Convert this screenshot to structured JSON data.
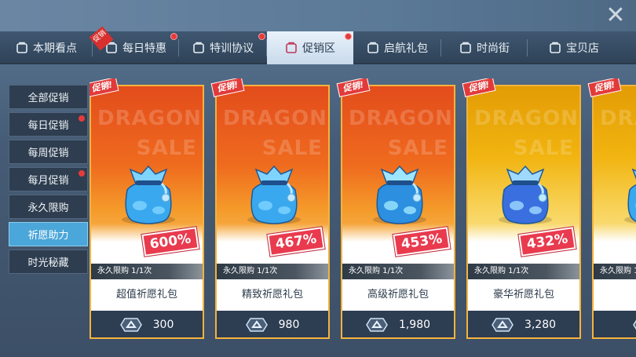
{
  "tabs": [
    {
      "label": "本期看点",
      "icon": "lock-bag-icon",
      "has_dot": false,
      "has_promo_tag": false,
      "active": false
    },
    {
      "label": "每日特惠",
      "icon": "flower-icon",
      "has_dot": true,
      "has_promo_tag": true,
      "active": false
    },
    {
      "label": "特训协议",
      "icon": "wings-icon",
      "has_dot": true,
      "has_promo_tag": false,
      "active": false
    },
    {
      "label": "促销区",
      "icon": "discount-icon",
      "has_dot": true,
      "has_promo_tag": false,
      "active": true
    },
    {
      "label": "启航礼包",
      "icon": "gift-icon",
      "has_dot": false,
      "has_promo_tag": false,
      "active": false
    },
    {
      "label": "时尚街",
      "icon": "hanger-icon",
      "has_dot": false,
      "has_promo_tag": false,
      "active": false
    },
    {
      "label": "宝贝店",
      "icon": "shop-icon",
      "has_dot": false,
      "has_promo_tag": false,
      "active": false
    }
  ],
  "promo_tag_text": "促销",
  "sidebar": [
    {
      "label": "全部促销",
      "active": false,
      "has_dot": false
    },
    {
      "label": "每日促销",
      "active": false,
      "has_dot": true
    },
    {
      "label": "每周促销",
      "active": false,
      "has_dot": false
    },
    {
      "label": "每月促销",
      "active": false,
      "has_dot": true
    },
    {
      "label": "永久限购",
      "active": false,
      "has_dot": false
    },
    {
      "label": "祈愿助力",
      "active": true,
      "has_dot": false
    },
    {
      "label": "时光秘藏",
      "active": false,
      "has_dot": false
    }
  ],
  "corner_tag": "促销!",
  "watermark": {
    "line1": "DRAGON",
    "line2": "SALE"
  },
  "cards": [
    {
      "percent": "600%",
      "limit": "永久限购 1/1次",
      "name": "超值祈愿礼包",
      "price": "300",
      "theme": "orange"
    },
    {
      "percent": "467%",
      "limit": "永久限购 1/1次",
      "name": "精致祈愿礼包",
      "price": "980",
      "theme": "orange"
    },
    {
      "percent": "453%",
      "limit": "永久限购 1/1次",
      "name": "高级祈愿礼包",
      "price": "1,980",
      "theme": "orange"
    },
    {
      "percent": "432%",
      "limit": "永久限购 1/1次",
      "name": "豪华祈愿礼包",
      "price": "3,280",
      "theme": "gold"
    },
    {
      "percent": "",
      "limit": "永久限购 1/1次",
      "name": "特",
      "price": "",
      "theme": "gold"
    }
  ],
  "colors": {
    "active_tab": "#e9f2fb",
    "sidebar_active": "#4ba6d9",
    "dot": "#e63b3b",
    "card_border": "#f4b33c"
  }
}
